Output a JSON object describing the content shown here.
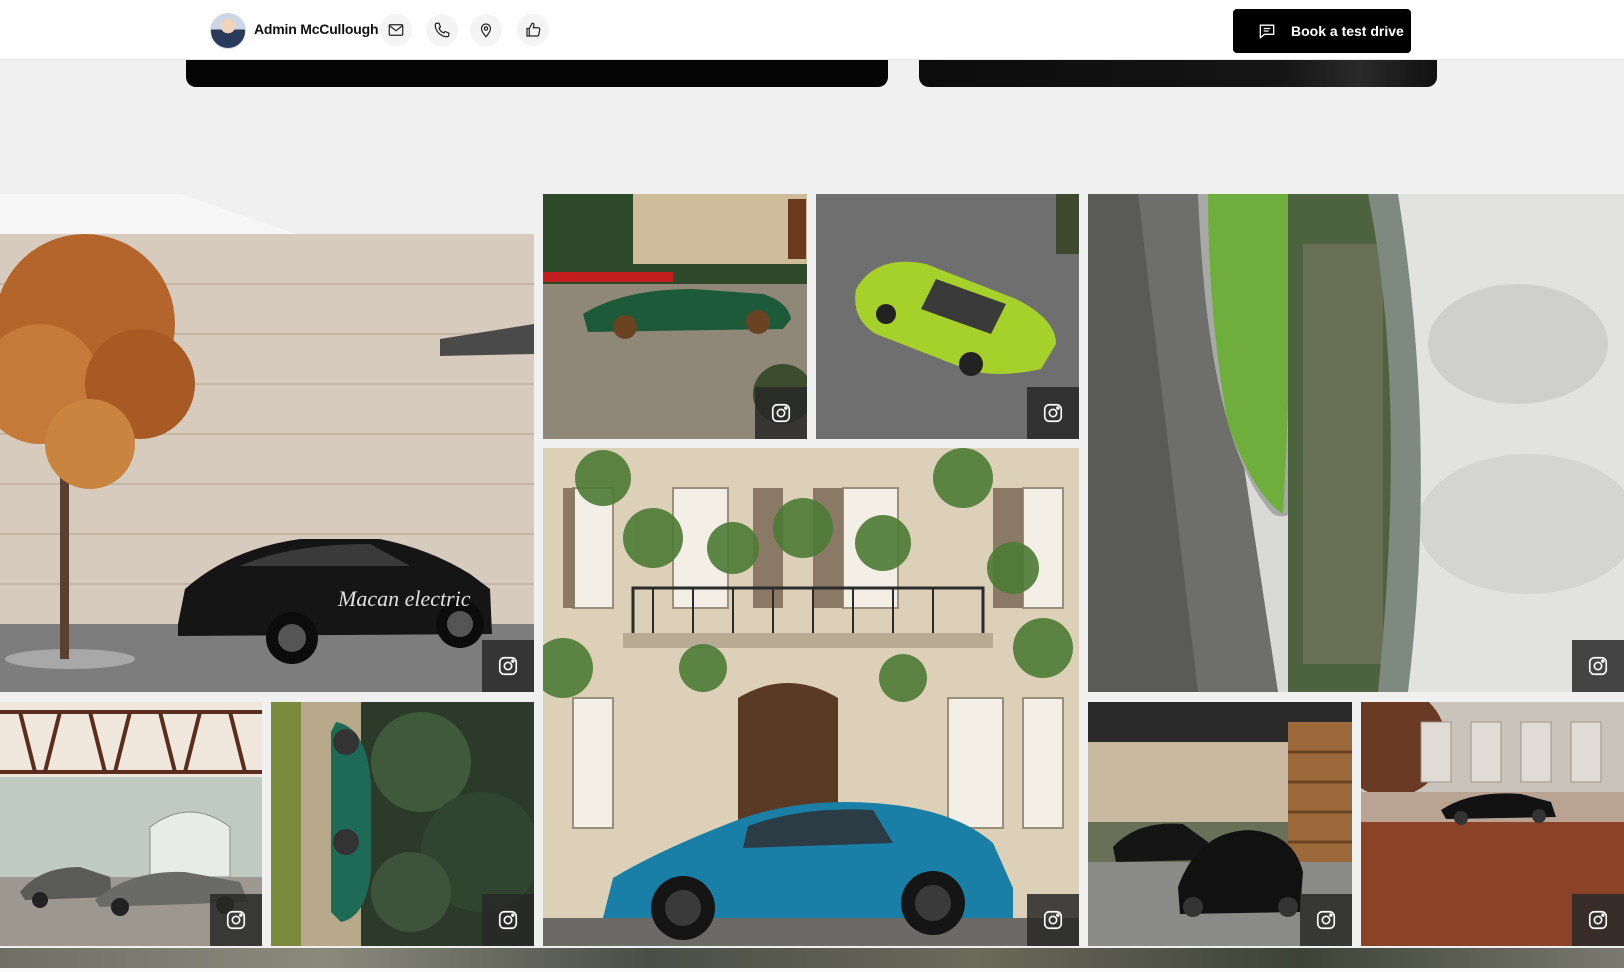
{
  "header": {
    "admin_name": "Admin McCullough",
    "cta_label": "Book a test drive",
    "icons": [
      "mail-icon",
      "phone-icon",
      "location-icon",
      "thumbs-up-icon",
      "chat-icon"
    ]
  },
  "gallery": {
    "tiles": [
      {
        "name": "tile-black-macan-electric",
        "photo_text": "Macan electric",
        "icon": "instagram-icon"
      },
      {
        "name": "tile-green-convertible",
        "icon": "instagram-icon"
      },
      {
        "name": "tile-lime-coupe",
        "icon": "instagram-icon"
      },
      {
        "name": "tile-aerial-road",
        "icon": "instagram-icon"
      },
      {
        "name": "tile-blue-coupe-house",
        "icon": "instagram-icon"
      },
      {
        "name": "tile-grey-cars-timber-house",
        "icon": "instagram-icon"
      },
      {
        "name": "tile-green-car-forest-path",
        "icon": "instagram-icon"
      },
      {
        "name": "tile-black-cars-garage",
        "icon": "instagram-icon"
      },
      {
        "name": "tile-black-convertible-plaza",
        "icon": "instagram-icon"
      }
    ]
  },
  "colors": {
    "topbar_bg": "#ffffff",
    "page_bg": "#f0f0f0",
    "cta_bg": "#000000",
    "cta_text": "#ffffff"
  }
}
